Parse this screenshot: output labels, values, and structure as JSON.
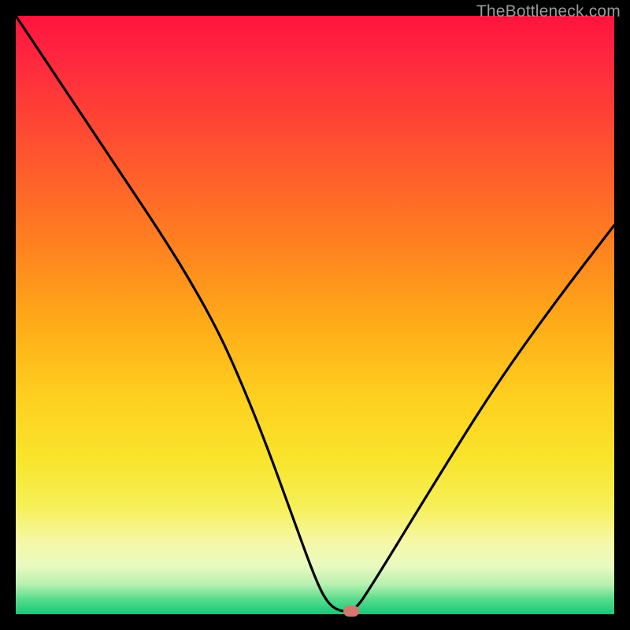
{
  "watermark": "TheBottleneck.com",
  "marker": {
    "color": "#d3786e"
  },
  "chart_data": {
    "type": "line",
    "title": "",
    "xlabel": "",
    "ylabel": "",
    "xlim": [
      0,
      100
    ],
    "ylim": [
      0,
      100
    ],
    "grid": false,
    "legend": false,
    "annotations": [],
    "series": [
      {
        "name": "bottleneck-curve",
        "x": [
          0,
          6,
          12,
          18,
          24,
          29,
          34,
          38,
          42,
          46,
          50,
          52,
          54,
          56.5,
          59,
          70,
          80,
          90,
          100
        ],
        "values": [
          100,
          91,
          82,
          73,
          64,
          56,
          47,
          38,
          28,
          17,
          6,
          2,
          0.5,
          0.5,
          4,
          22,
          38,
          52,
          65
        ]
      }
    ],
    "marker_point": {
      "x": 56,
      "y": 0.5
    },
    "background_gradient": {
      "stops": [
        {
          "pos": 0,
          "color": "#ff143c"
        },
        {
          "pos": 22,
          "color": "#ff5130"
        },
        {
          "pos": 52,
          "color": "#ffad18"
        },
        {
          "pos": 74,
          "color": "#f9e42c"
        },
        {
          "pos": 88,
          "color": "#f6f8a8"
        },
        {
          "pos": 100,
          "color": "#14c878"
        }
      ]
    }
  }
}
